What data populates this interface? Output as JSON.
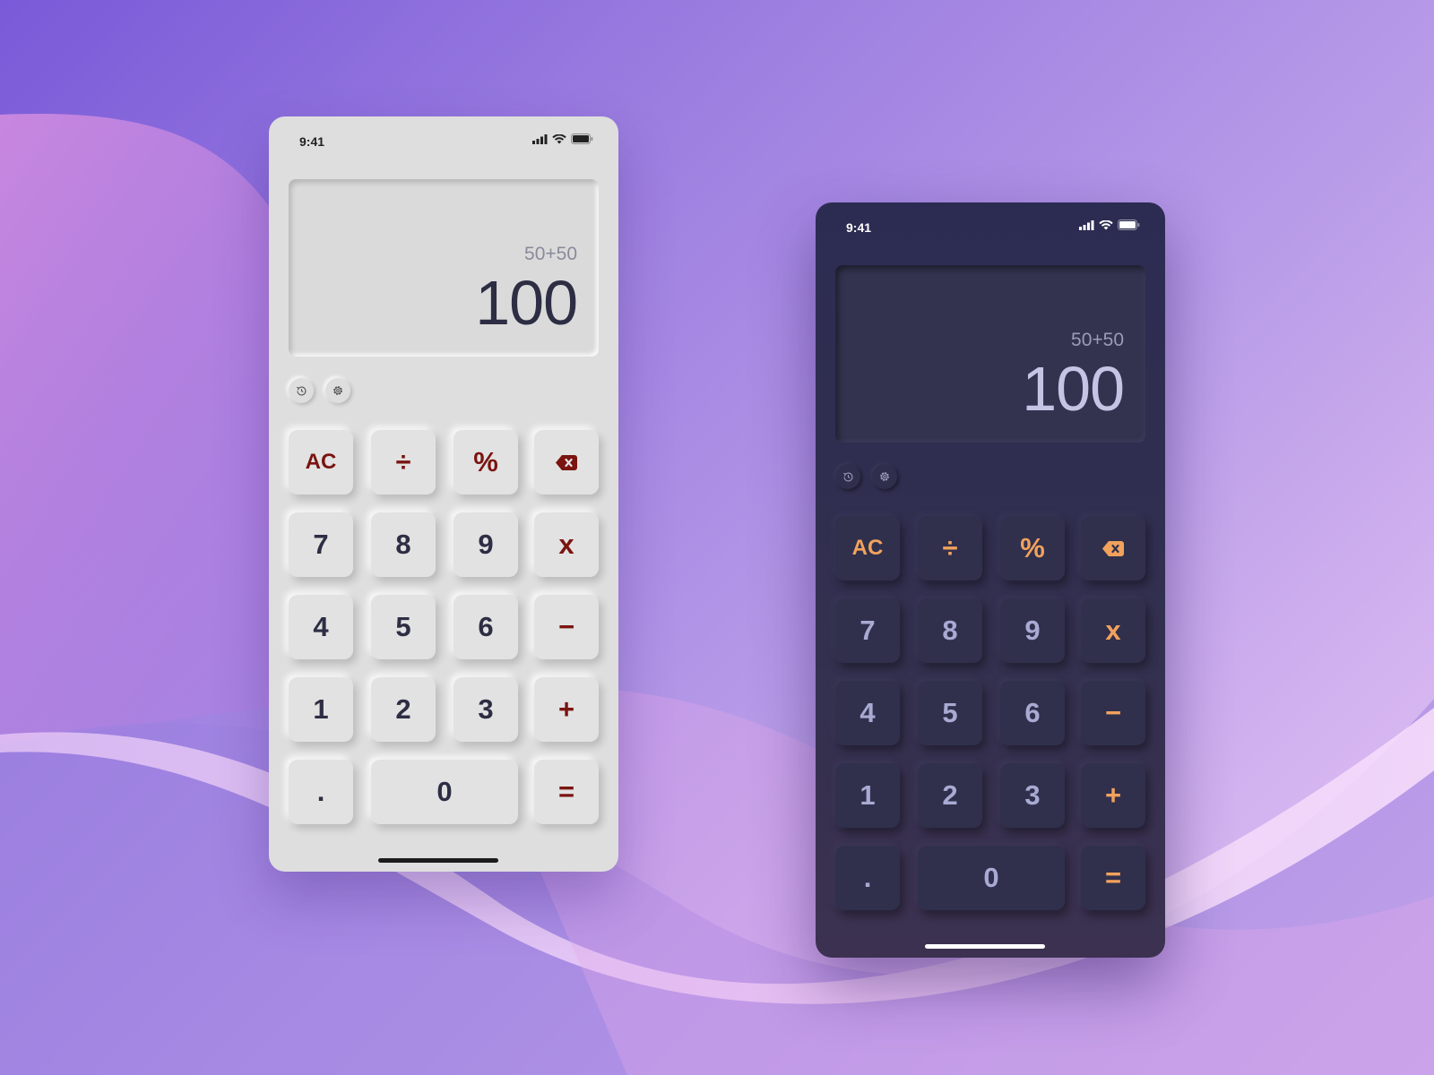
{
  "colors": {
    "light_background": "#dedede",
    "light_operator": "#7a1410",
    "light_digit": "#2d2d44",
    "dark_background": "#2c2c52",
    "dark_operator": "#f2a25c",
    "dark_digit": "#a9aad3"
  },
  "light": {
    "time": "9:41",
    "expression": "50+50",
    "result": "100",
    "keys": {
      "ac": "AC",
      "divide": "÷",
      "percent": "%",
      "seven": "7",
      "eight": "8",
      "nine": "9",
      "multiply": "x",
      "four": "4",
      "five": "5",
      "six": "6",
      "minus": "−",
      "one": "1",
      "two": "2",
      "three": "3",
      "plus": "+",
      "dot": ".",
      "zero": "0",
      "equals": "="
    }
  },
  "dark": {
    "time": "9:41",
    "expression": "50+50",
    "result": "100",
    "keys": {
      "ac": "AC",
      "divide": "÷",
      "percent": "%",
      "seven": "7",
      "eight": "8",
      "nine": "9",
      "multiply": "x",
      "four": "4",
      "five": "5",
      "six": "6",
      "minus": "−",
      "one": "1",
      "two": "2",
      "three": "3",
      "plus": "+",
      "dot": ".",
      "zero": "0",
      "equals": "="
    }
  },
  "icons": [
    "signal-icon",
    "wifi-icon",
    "battery-icon",
    "history-icon",
    "settings-icon",
    "backspace-icon"
  ]
}
